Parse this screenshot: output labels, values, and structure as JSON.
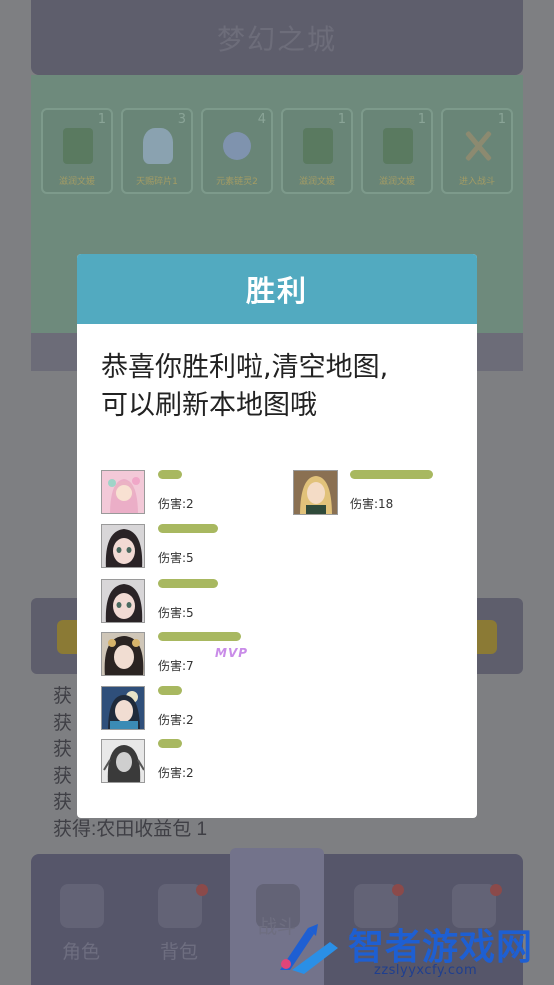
{
  "background": {
    "map_title": "梦幻之城",
    "rewards": [
      {
        "name": "滋润文媛",
        "count": "1",
        "icon": "green-book-icon"
      },
      {
        "name": "天赐碎片1",
        "count": "3",
        "icon": "crystal-icon"
      },
      {
        "name": "元素链灵2",
        "count": "4",
        "icon": "gem-icon"
      },
      {
        "name": "滋润文媛",
        "count": "1",
        "icon": "green-book-icon"
      },
      {
        "name": "滋润文媛",
        "count": "1",
        "icon": "green-book-icon"
      },
      {
        "name": "进入战斗",
        "count": "1",
        "icon": "crossed-swords-icon"
      }
    ],
    "log_lines": [
      "获",
      "获",
      "获",
      "获",
      "获",
      "获得:农田收益包 1"
    ],
    "tabs": [
      {
        "label": "角色",
        "icon": "helmet-icon",
        "badge": false
      },
      {
        "label": "背包",
        "icon": "bag-icon",
        "badge": true
      },
      {
        "label": "战斗",
        "icon": "sword-icon",
        "badge": false,
        "active": true
      },
      {
        "label": "",
        "icon": "house-icon",
        "badge": true
      },
      {
        "label": "",
        "icon": "tower-icon",
        "badge": true
      }
    ]
  },
  "modal": {
    "title": "胜利",
    "message_line1": "恭喜你胜利啦,清空地图,",
    "message_line2": "可以刷新本地图哦",
    "heroes_left": [
      {
        "damage": "伤害:2",
        "hp": 0.26
      },
      {
        "damage": "伤害:5",
        "hp": 0.65
      },
      {
        "damage": "伤害:5",
        "hp": 0.65
      },
      {
        "damage": "伤害:7",
        "hp": 0.9,
        "mvp": true
      },
      {
        "damage": "伤害:2",
        "hp": 0.26
      },
      {
        "damage": "伤害:2",
        "hp": 0.26
      }
    ],
    "heroes_right": [
      {
        "damage": "伤害:18",
        "hp": 0.9
      }
    ],
    "mvp_label": "MVP"
  },
  "watermark": {
    "brand": "智者游戏网",
    "url": "zzslyyxcfy.com"
  },
  "colors": {
    "header": "#52aac0",
    "hp_bar": "#a8b860",
    "watermark_blue": "#1e5fd2"
  }
}
